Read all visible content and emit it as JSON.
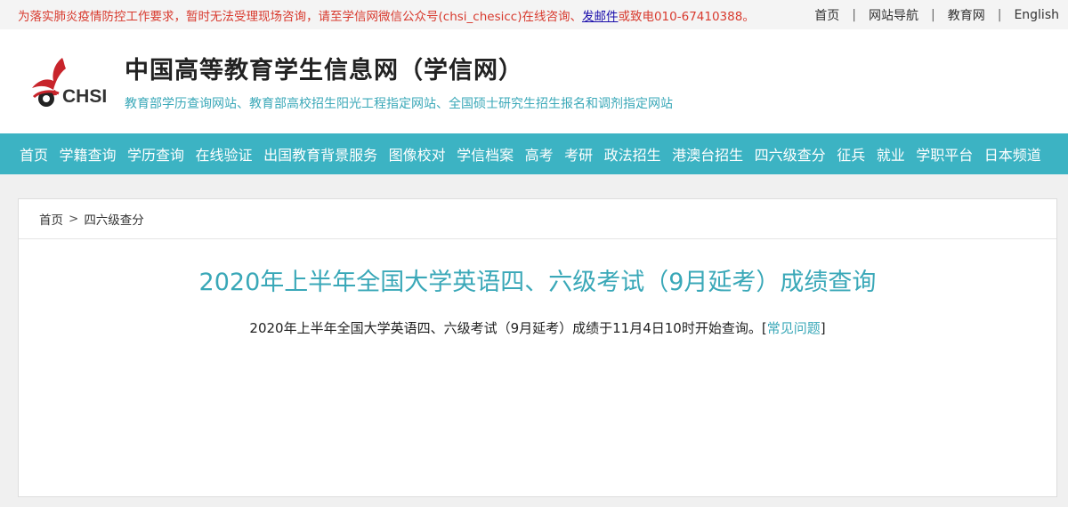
{
  "topbar": {
    "notice_prefix": "为落实肺炎疫情防控工作要求，暂时无法受理现场咨询，请至学信网微信公众号(chsi_chesicc)在线咨询、",
    "notice_link": "发邮件",
    "notice_suffix": "或致电010-67410388。",
    "links": [
      "首页",
      "网站导航",
      "教育网",
      "English"
    ],
    "separator": "|"
  },
  "header": {
    "logo_text": "CHSI",
    "title": "中国高等教育学生信息网（学信网）",
    "subtitle": "教育部学历查询网站、教育部高校招生阳光工程指定网站、全国硕士研究生招生报名和调剂指定网站"
  },
  "nav": [
    "首页",
    "学籍查询",
    "学历查询",
    "在线验证",
    "出国教育背景服务",
    "图像校对",
    "学信档案",
    "高考",
    "考研",
    "政法招生",
    "港澳台招生",
    "四六级查分",
    "征兵",
    "就业",
    "学职平台",
    "日本频道"
  ],
  "breadcrumb": {
    "home": "首页",
    "separator": ">",
    "current": "四六级查分"
  },
  "content": {
    "title": "2020年上半年全国大学英语四、六级考试（9月延考）成绩查询",
    "desc_text": "2020年上半年全国大学英语四、六级考试（9月延考）成绩于11月4日10时开始查询。",
    "faq_open": "[",
    "faq_link": "常见问题",
    "faq_close": "]"
  },
  "colors": {
    "accent": "#3cb3c3",
    "notice": "#d83a2e",
    "link_blue": "#1a0dab"
  }
}
